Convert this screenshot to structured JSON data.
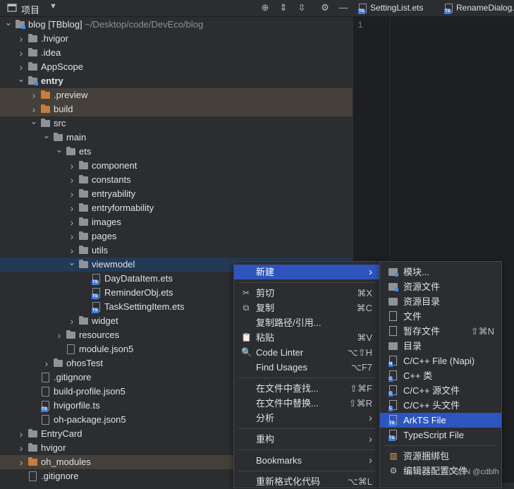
{
  "project_panel": {
    "title": "项目",
    "tree": [
      {
        "label": "blog [TBblog]",
        "extra": "~/Desktop/code/DevEco/blog",
        "depth": 0,
        "arrow": "down",
        "icon": "folder-module"
      },
      {
        "label": ".hvigor",
        "depth": 1,
        "arrow": "right",
        "icon": "folder"
      },
      {
        "label": ".idea",
        "depth": 1,
        "arrow": "right",
        "icon": "folder"
      },
      {
        "label": "AppScope",
        "depth": 1,
        "arrow": "right",
        "icon": "folder"
      },
      {
        "label": "entry",
        "depth": 1,
        "arrow": "down",
        "icon": "folder-module",
        "bold": true
      },
      {
        "label": ".preview",
        "depth": 2,
        "arrow": "right",
        "icon": "folder-orange",
        "excluded": true
      },
      {
        "label": "build",
        "depth": 2,
        "arrow": "right",
        "icon": "folder-orange",
        "excluded": true
      },
      {
        "label": "src",
        "depth": 2,
        "arrow": "down",
        "icon": "folder"
      },
      {
        "label": "main",
        "depth": 3,
        "arrow": "down",
        "icon": "folder"
      },
      {
        "label": "ets",
        "depth": 4,
        "arrow": "down",
        "icon": "folder"
      },
      {
        "label": "component",
        "depth": 5,
        "arrow": "right",
        "icon": "folder"
      },
      {
        "label": "constants",
        "depth": 5,
        "arrow": "right",
        "icon": "folder"
      },
      {
        "label": "entryability",
        "depth": 5,
        "arrow": "right",
        "icon": "folder"
      },
      {
        "label": "entryformability",
        "depth": 5,
        "arrow": "right",
        "icon": "folder"
      },
      {
        "label": "images",
        "depth": 5,
        "arrow": "right",
        "icon": "folder"
      },
      {
        "label": "pages",
        "depth": 5,
        "arrow": "right",
        "icon": "folder"
      },
      {
        "label": "utils",
        "depth": 5,
        "arrow": "right",
        "icon": "folder"
      },
      {
        "label": "viewmodel",
        "depth": 5,
        "arrow": "down",
        "icon": "folder",
        "selected": true
      },
      {
        "label": "DayDataItem.ets",
        "depth": 6,
        "arrow": "",
        "icon": "file-ts"
      },
      {
        "label": "ReminderObj.ets",
        "depth": 6,
        "arrow": "",
        "icon": "file-ts"
      },
      {
        "label": "TaskSettingItem.ets",
        "depth": 6,
        "arrow": "",
        "icon": "file-ts"
      },
      {
        "label": "widget",
        "depth": 5,
        "arrow": "right",
        "icon": "folder"
      },
      {
        "label": "resources",
        "depth": 4,
        "arrow": "right",
        "icon": "folder"
      },
      {
        "label": "module.json5",
        "depth": 4,
        "arrow": "",
        "icon": "file"
      },
      {
        "label": "ohosTest",
        "depth": 3,
        "arrow": "right",
        "icon": "folder"
      },
      {
        "label": ".gitignore",
        "depth": 2,
        "arrow": "",
        "icon": "file"
      },
      {
        "label": "build-profile.json5",
        "depth": 2,
        "arrow": "",
        "icon": "file"
      },
      {
        "label": "hvigorfile.ts",
        "depth": 2,
        "arrow": "",
        "icon": "file-ts"
      },
      {
        "label": "oh-package.json5",
        "depth": 2,
        "arrow": "",
        "icon": "file"
      },
      {
        "label": "EntryCard",
        "depth": 1,
        "arrow": "right",
        "icon": "folder"
      },
      {
        "label": "hvigor",
        "depth": 1,
        "arrow": "right",
        "icon": "folder"
      },
      {
        "label": "oh_modules",
        "depth": 1,
        "arrow": "right",
        "icon": "folder-orange",
        "excluded": true
      },
      {
        "label": ".gitignore",
        "depth": 1,
        "arrow": "",
        "icon": "file"
      }
    ]
  },
  "editor": {
    "tabs": [
      "SettingList.ets",
      "RenameDialog.e"
    ],
    "line_number": "1"
  },
  "context_menu": {
    "items": [
      {
        "type": "item",
        "label": "新建",
        "icon": "",
        "shortcut": "",
        "submenu": true,
        "highlighted": true
      },
      {
        "type": "sep"
      },
      {
        "type": "item",
        "label": "剪切",
        "icon": "✂",
        "shortcut": "⌘X"
      },
      {
        "type": "item",
        "label": "复制",
        "icon": "⧉",
        "shortcut": "⌘C"
      },
      {
        "type": "item",
        "label": "复制路径/引用...",
        "icon": "",
        "shortcut": ""
      },
      {
        "type": "item",
        "label": "粘贴",
        "icon": "📋",
        "shortcut": "⌘V"
      },
      {
        "type": "item",
        "label": "Code Linter",
        "icon": "🔍",
        "shortcut": "⌥⇧H"
      },
      {
        "type": "item",
        "label": "Find Usages",
        "icon": "",
        "shortcut": "⌥F7"
      },
      {
        "type": "sep"
      },
      {
        "type": "item",
        "label": "在文件中查找...",
        "icon": "",
        "shortcut": "⇧⌘F"
      },
      {
        "type": "item",
        "label": "在文件中替换...",
        "icon": "",
        "shortcut": "⇧⌘R"
      },
      {
        "type": "item",
        "label": "分析",
        "icon": "",
        "shortcut": "",
        "submenu": true
      },
      {
        "type": "sep"
      },
      {
        "type": "item",
        "label": "重构",
        "icon": "",
        "shortcut": "",
        "submenu": true
      },
      {
        "type": "sep"
      },
      {
        "type": "item",
        "label": "Bookmarks",
        "icon": "",
        "shortcut": "",
        "submenu": true
      },
      {
        "type": "sep"
      },
      {
        "type": "item",
        "label": "重新格式化代码",
        "icon": "",
        "shortcut": "⌥⌘L"
      }
    ]
  },
  "new_submenu": {
    "items": [
      {
        "type": "item",
        "label": "模块...",
        "icon": "folder-module",
        "shortcut": ""
      },
      {
        "type": "item",
        "label": "资源文件",
        "icon": "folder-module",
        "shortcut": ""
      },
      {
        "type": "item",
        "label": "资源目录",
        "icon": "folder",
        "shortcut": ""
      },
      {
        "type": "item",
        "label": "文件",
        "icon": "file",
        "shortcut": ""
      },
      {
        "type": "item",
        "label": "暂存文件",
        "icon": "file",
        "shortcut": "⇧⌘N"
      },
      {
        "type": "item",
        "label": "目录",
        "icon": "folder",
        "shortcut": ""
      },
      {
        "type": "item",
        "label": "C/C++ File (Napi)",
        "icon": "file-napi",
        "shortcut": ""
      },
      {
        "type": "item",
        "label": "C++ 类",
        "icon": "file-cpp",
        "shortcut": ""
      },
      {
        "type": "item",
        "label": "C/C++ 源文件",
        "icon": "file-cpp",
        "shortcut": ""
      },
      {
        "type": "item",
        "label": "C/C++ 头文件",
        "icon": "file-cpp",
        "shortcut": ""
      },
      {
        "type": "item",
        "label": "ArkTS File",
        "icon": "file-ts",
        "shortcut": "",
        "highlighted": true
      },
      {
        "type": "item",
        "label": "TypeScript File",
        "icon": "file-ts",
        "shortcut": ""
      },
      {
        "type": "sep"
      },
      {
        "type": "item",
        "label": "资源捆绑包",
        "icon": "bundle",
        "shortcut": ""
      },
      {
        "type": "item",
        "label": "编辑器配置文件",
        "icon": "gear",
        "shortcut": ""
      }
    ]
  },
  "watermark": "CSDN @cdblh"
}
